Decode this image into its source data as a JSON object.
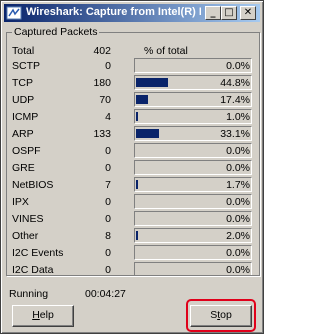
{
  "window": {
    "title": "Wireshark: Capture from Intel(R) PRO/..."
  },
  "titlebar_buttons": {
    "minimize": "_",
    "maximize": "□",
    "close": "✕"
  },
  "group": {
    "label": "Captured Packets"
  },
  "headers": {
    "name": "Total",
    "count": "402",
    "percent_label": "% of total"
  },
  "rows": [
    {
      "name": "SCTP",
      "count": "0",
      "percent": "0.0%",
      "fraction": 0.0
    },
    {
      "name": "TCP",
      "count": "180",
      "percent": "44.8%",
      "fraction": 0.448
    },
    {
      "name": "UDP",
      "count": "70",
      "percent": "17.4%",
      "fraction": 0.174
    },
    {
      "name": "ICMP",
      "count": "4",
      "percent": "1.0%",
      "fraction": 0.01
    },
    {
      "name": "ARP",
      "count": "133",
      "percent": "33.1%",
      "fraction": 0.331
    },
    {
      "name": "OSPF",
      "count": "0",
      "percent": "0.0%",
      "fraction": 0.0
    },
    {
      "name": "GRE",
      "count": "0",
      "percent": "0.0%",
      "fraction": 0.0
    },
    {
      "name": "NetBIOS",
      "count": "7",
      "percent": "1.7%",
      "fraction": 0.017
    },
    {
      "name": "IPX",
      "count": "0",
      "percent": "0.0%",
      "fraction": 0.0
    },
    {
      "name": "VINES",
      "count": "0",
      "percent": "0.0%",
      "fraction": 0.0
    },
    {
      "name": "Other",
      "count": "8",
      "percent": "2.0%",
      "fraction": 0.02
    },
    {
      "name": "I2C Events",
      "count": "0",
      "percent": "0.0%",
      "fraction": 0.0
    },
    {
      "name": "I2C Data",
      "count": "0",
      "percent": "0.0%",
      "fraction": 0.0
    }
  ],
  "status": {
    "label": "Running",
    "elapsed": "00:04:27"
  },
  "buttons": {
    "help_prefix": "",
    "help_mnemonic": "H",
    "help_rest": "elp",
    "stop_prefix": "S",
    "stop_mnemonic": "t",
    "stop_rest": "op"
  },
  "colors": {
    "bar_fill": "#0a246a",
    "highlight": "#e0001a",
    "title_bar": "#0a246a"
  }
}
